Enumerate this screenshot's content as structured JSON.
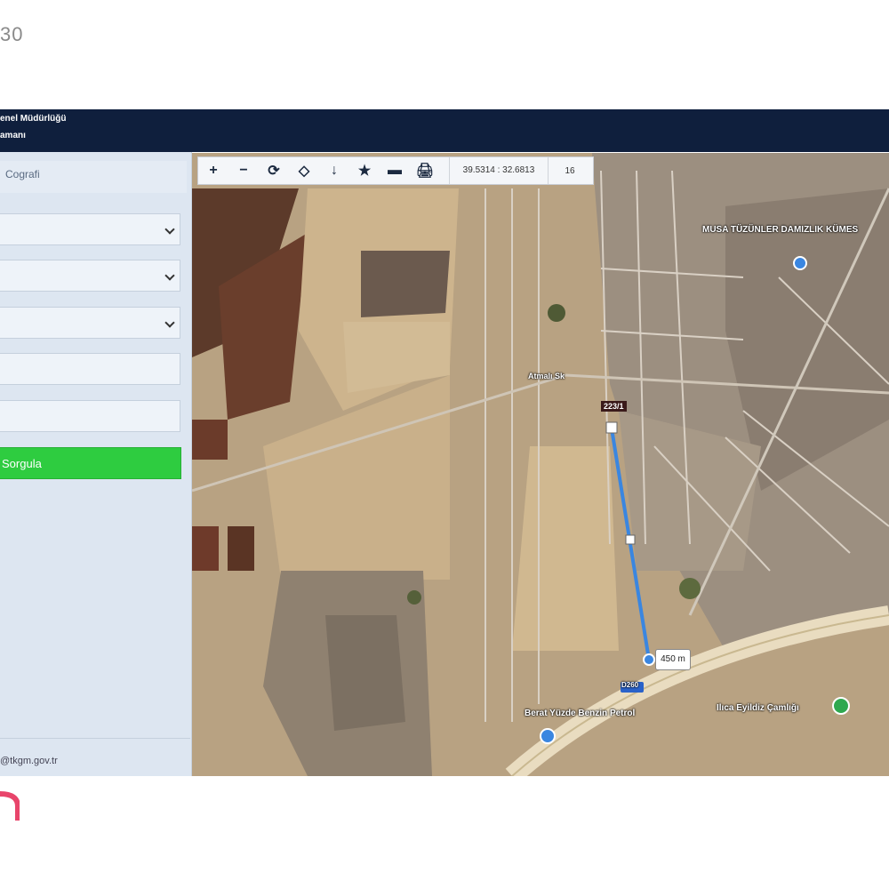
{
  "corner_text": "30",
  "header": {
    "org_line1": "enel Müdürlüğü",
    "org_line2": "amanı"
  },
  "sidebar": {
    "tab_label": "Cografi",
    "query_button": "Sorgula",
    "contact": "@tkgm.gov.tr"
  },
  "toolbar": {
    "buttons": [
      "+",
      "−",
      "⟳",
      "◇",
      "↓",
      "★",
      "▬",
      "🖨"
    ],
    "coordinates": "39.5314 : 32.6813",
    "zoom": "16"
  },
  "map": {
    "parcel_label": "223/1",
    "distance_label": "450 m",
    "road_label": "D260",
    "places": {
      "village": "MUSA TÜZÜNLER DAMIZLIK KÜMES",
      "street": "Atmalı Sk",
      "fuel": "Berat Yüzde Benzin Petrol",
      "eatery": "Ilıca Eyildiz Çamlığı"
    }
  },
  "colors": {
    "header_bg": "#0f1f3d",
    "sidebar_bg": "#dde6f1",
    "query_button": "#2ecc40",
    "route_line": "#3a86e0",
    "brand_mark": "#e8456b"
  }
}
